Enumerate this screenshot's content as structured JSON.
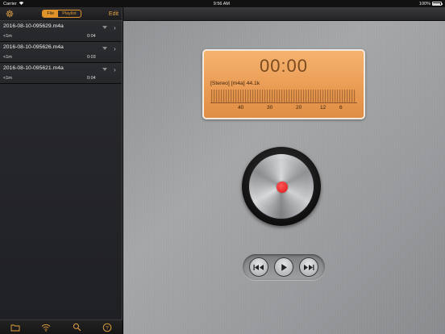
{
  "status_bar": {
    "carrier": "Carrier",
    "time": "9:56 AM",
    "battery": "100%"
  },
  "sidebar": {
    "segment": {
      "file_label": "File",
      "playlist_label": "Playlist",
      "selected": "File"
    },
    "edit_label": "Edit",
    "recordings": [
      {
        "name": "2016-08-10-095629.m4a",
        "size": "<1m",
        "duration": "0:04"
      },
      {
        "name": "2016-08-10-095626.m4a",
        "size": "<1m",
        "duration": "0:03"
      },
      {
        "name": "2016-08-10-095621.m4a",
        "size": "<1m",
        "duration": "0:04"
      }
    ],
    "bottom_icons": [
      "folder-icon",
      "wifi-icon",
      "search-icon",
      "help-icon"
    ]
  },
  "recorder": {
    "timer": "00:00",
    "format": "[Stereo] [m4a] 44.1k",
    "meter_scale": [
      "40",
      "30",
      "20",
      "12",
      "6"
    ]
  },
  "colors": {
    "accent": "#e0932b",
    "display_bg": "#e99a52",
    "record": "#e01e1e"
  }
}
